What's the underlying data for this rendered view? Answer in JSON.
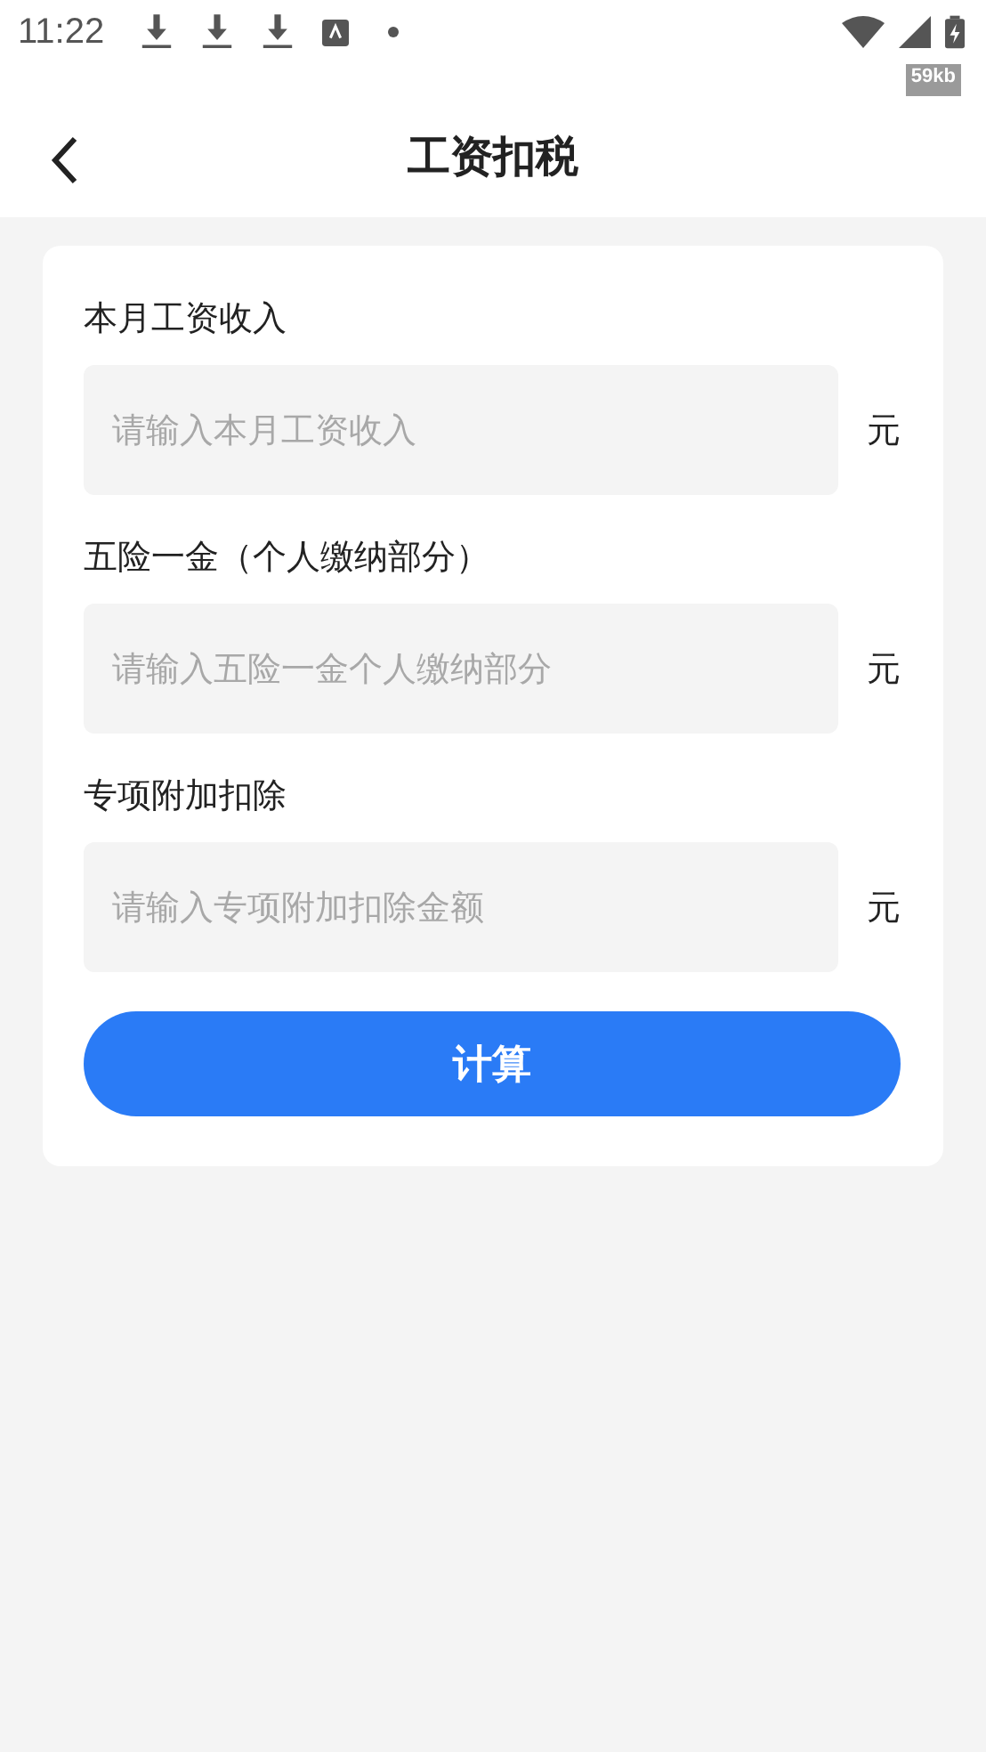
{
  "status_bar": {
    "time": "11:22",
    "speed": "59kb"
  },
  "header": {
    "title": "工资扣税"
  },
  "fields": [
    {
      "label": "本月工资收入",
      "placeholder": "请输入本月工资收入",
      "unit": "元"
    },
    {
      "label": "五险一金（个人缴纳部分）",
      "placeholder": "请输入五险一金个人缴纳部分",
      "unit": "元"
    },
    {
      "label": "专项附加扣除",
      "placeholder": "请输入专项附加扣除金额",
      "unit": "元"
    }
  ],
  "button": {
    "label": "计算"
  }
}
